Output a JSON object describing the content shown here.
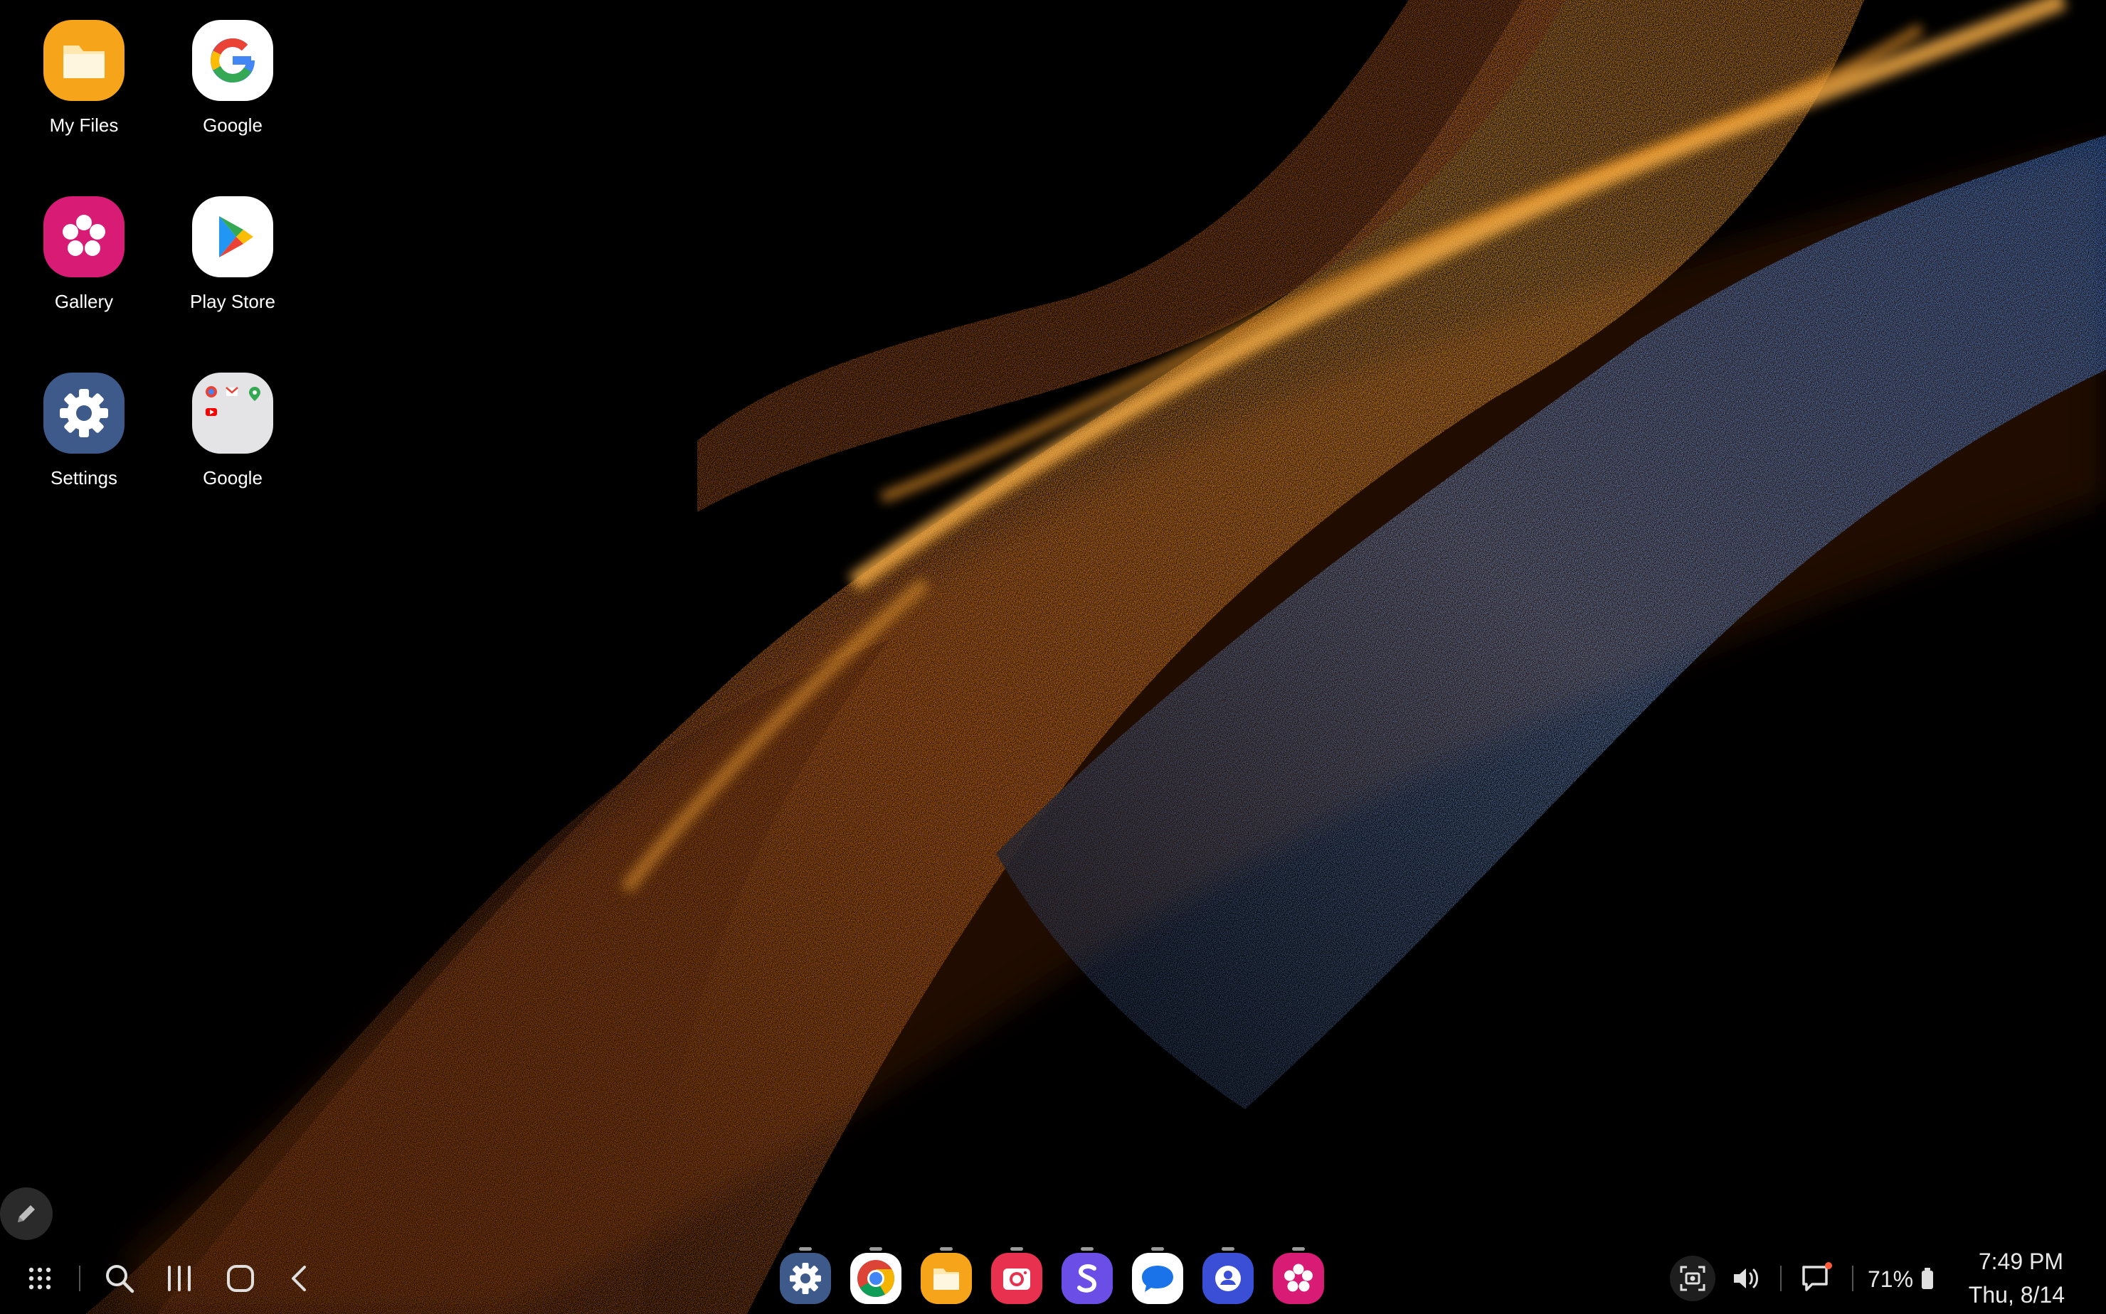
{
  "desktop": {
    "icons": [
      {
        "label": "My Files",
        "icon": "my-files-icon"
      },
      {
        "label": "Google",
        "icon": "google-icon"
      },
      {
        "label": "Gallery",
        "icon": "gallery-icon"
      },
      {
        "label": "Play Store",
        "icon": "play-store-icon"
      },
      {
        "label": "Settings",
        "icon": "settings-icon"
      },
      {
        "label": "Google",
        "icon": "google-folder-icon"
      }
    ]
  },
  "taskbar": {
    "left_buttons": [
      "apps-grid-icon",
      "search-icon",
      "recents-icon",
      "home-icon",
      "back-icon"
    ],
    "dock_apps": [
      "settings-app-icon",
      "chrome-icon",
      "my-files-icon",
      "camera-icon",
      "samsung-internet-icon",
      "messages-icon",
      "contacts-icon",
      "gallery-icon"
    ],
    "status": {
      "battery": "71%",
      "time": "7:49 PM",
      "date": "Thu, 8/14"
    }
  },
  "colors": {
    "wallpaper_orange": "#e8892a",
    "wallpaper_blue": "#4f8fe0",
    "gallery": "#d81b74",
    "my_files": "#f6a51a",
    "settings": "#3d5a8a"
  }
}
